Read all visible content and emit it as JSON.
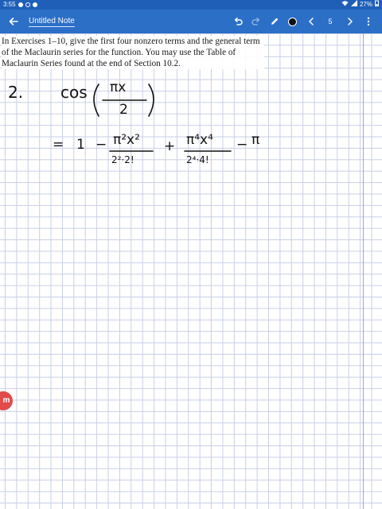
{
  "status_bar": {
    "time": "3:55",
    "battery": "27%"
  },
  "app_bar": {
    "back_icon": "arrow-left-icon",
    "title": "Untitled Note",
    "undo_icon": "undo-icon",
    "redo_icon": "redo-icon",
    "pen_icon": "pen-icon",
    "pen_color": "#111111",
    "prev_icon": "chevron-left-icon",
    "page_number": "5",
    "next_icon": "chevron-right-icon",
    "more_icon": "more-vertical-icon",
    "bar_color": "#2b6fc7"
  },
  "note": {
    "prompt": "In Exercises 1–10, give the first four nonzero terms and the general term of the Maclaurin series for the function. You may use the Table of Maclaurin Series found at the end of Section 10.2.",
    "handwriting": {
      "number": "2.",
      "func": "cos",
      "paren_num": "πx",
      "paren_den": "2",
      "equals": "=",
      "one": "1",
      "minus1": "−",
      "t1_num": "π²x²",
      "t1_den": "2²·2!",
      "plus": "+",
      "t2_num": "π⁴x⁴",
      "t2_den": "2⁴·4!",
      "minus2": "−",
      "t3_partial": "π"
    },
    "badge_label": "m"
  }
}
